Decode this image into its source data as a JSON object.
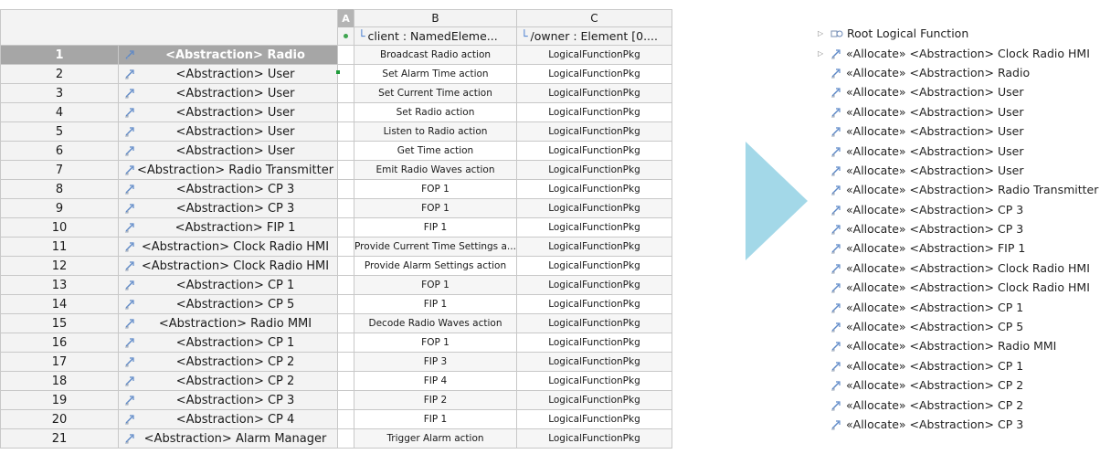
{
  "grid": {
    "col_headers": {
      "a": "A",
      "b": "B",
      "c": "C"
    },
    "sub_headers": {
      "b": "client : NamedEleme...",
      "c": "/owner : Element [0...."
    },
    "rows": [
      {
        "num": "1",
        "name": "<Abstraction> Radio",
        "client": "Broadcast Radio action",
        "owner": "LogicalFunctionPkg",
        "selected": true
      },
      {
        "num": "2",
        "name": "<Abstraction> User",
        "client": "Set Alarm Time action",
        "owner": "LogicalFunctionPkg"
      },
      {
        "num": "3",
        "name": "<Abstraction> User",
        "client": "Set Current Time action",
        "owner": "LogicalFunctionPkg"
      },
      {
        "num": "4",
        "name": "<Abstraction> User",
        "client": "Set Radio action",
        "owner": "LogicalFunctionPkg"
      },
      {
        "num": "5",
        "name": "<Abstraction> User",
        "client": "Listen to Radio action",
        "owner": "LogicalFunctionPkg"
      },
      {
        "num": "6",
        "name": "<Abstraction> User",
        "client": "Get Time action",
        "owner": "LogicalFunctionPkg"
      },
      {
        "num": "7",
        "name": "<Abstraction> Radio Transmitter",
        "client": "Emit Radio Waves action",
        "owner": "LogicalFunctionPkg"
      },
      {
        "num": "8",
        "name": "<Abstraction> CP 3",
        "client": "FOP 1",
        "owner": "LogicalFunctionPkg"
      },
      {
        "num": "9",
        "name": "<Abstraction> CP 3",
        "client": "FOP 1",
        "owner": "LogicalFunctionPkg"
      },
      {
        "num": "10",
        "name": "<Abstraction> FIP 1",
        "client": "FIP 1",
        "owner": "LogicalFunctionPkg"
      },
      {
        "num": "11",
        "name": "<Abstraction> Clock Radio HMI",
        "client": "Provide Current Time Settings a...",
        "owner": "LogicalFunctionPkg"
      },
      {
        "num": "12",
        "name": "<Abstraction> Clock Radio HMI",
        "client": "Provide Alarm Settings action",
        "owner": "LogicalFunctionPkg"
      },
      {
        "num": "13",
        "name": "<Abstraction> CP 1",
        "client": "FOP 1",
        "owner": "LogicalFunctionPkg"
      },
      {
        "num": "14",
        "name": "<Abstraction> CP 5",
        "client": "FIP 1",
        "owner": "LogicalFunctionPkg"
      },
      {
        "num": "15",
        "name": "<Abstraction> Radio MMI",
        "client": "Decode Radio Waves action",
        "owner": "LogicalFunctionPkg"
      },
      {
        "num": "16",
        "name": "<Abstraction> CP 1",
        "client": "FOP 1",
        "owner": "LogicalFunctionPkg"
      },
      {
        "num": "17",
        "name": "<Abstraction> CP 2",
        "client": "FIP 3",
        "owner": "LogicalFunctionPkg"
      },
      {
        "num": "18",
        "name": "<Abstraction> CP 2",
        "client": "FIP 4",
        "owner": "LogicalFunctionPkg"
      },
      {
        "num": "19",
        "name": "<Abstraction> CP 3",
        "client": "FIP 2",
        "owner": "LogicalFunctionPkg"
      },
      {
        "num": "20",
        "name": "<Abstraction> CP 4",
        "client": "FIP 1",
        "owner": "LogicalFunctionPkg"
      },
      {
        "num": "21",
        "name": "<Abstraction> Alarm Manager",
        "client": "Trigger Alarm action",
        "owner": "LogicalFunctionPkg"
      }
    ]
  },
  "arrow_color": "#a3d8e8",
  "selection_color": "#a6a6a6",
  "tree": [
    {
      "label": "Root Logical Function",
      "icon": "root-function-icon",
      "expandable": true
    },
    {
      "label": "«Allocate» <Abstraction> Clock Radio HMI",
      "icon": "allocate-icon",
      "expandable": true
    },
    {
      "label": "«Allocate» <Abstraction> Radio",
      "icon": "allocate-icon"
    },
    {
      "label": "«Allocate» <Abstraction> User",
      "icon": "allocate-icon"
    },
    {
      "label": "«Allocate» <Abstraction> User",
      "icon": "allocate-icon"
    },
    {
      "label": "«Allocate» <Abstraction> User",
      "icon": "allocate-icon"
    },
    {
      "label": "«Allocate» <Abstraction> User",
      "icon": "allocate-icon"
    },
    {
      "label": "«Allocate» <Abstraction> User",
      "icon": "allocate-icon"
    },
    {
      "label": "«Allocate» <Abstraction> Radio Transmitter",
      "icon": "allocate-icon"
    },
    {
      "label": "«Allocate» <Abstraction> CP 3",
      "icon": "allocate-icon"
    },
    {
      "label": "«Allocate» <Abstraction> CP 3",
      "icon": "allocate-icon"
    },
    {
      "label": "«Allocate» <Abstraction> FIP 1",
      "icon": "allocate-icon"
    },
    {
      "label": "«Allocate» <Abstraction> Clock Radio HMI",
      "icon": "allocate-icon"
    },
    {
      "label": "«Allocate» <Abstraction> Clock Radio HMI",
      "icon": "allocate-icon"
    },
    {
      "label": "«Allocate» <Abstraction> CP 1",
      "icon": "allocate-icon"
    },
    {
      "label": "«Allocate» <Abstraction> CP 5",
      "icon": "allocate-icon"
    },
    {
      "label": "«Allocate» <Abstraction> Radio MMI",
      "icon": "allocate-icon"
    },
    {
      "label": "«Allocate» <Abstraction> CP 1",
      "icon": "allocate-icon"
    },
    {
      "label": "«Allocate» <Abstraction> CP 2",
      "icon": "allocate-icon"
    },
    {
      "label": "«Allocate» <Abstraction> CP 2",
      "icon": "allocate-icon"
    },
    {
      "label": "«Allocate» <Abstraction> CP 3",
      "icon": "allocate-icon"
    }
  ]
}
